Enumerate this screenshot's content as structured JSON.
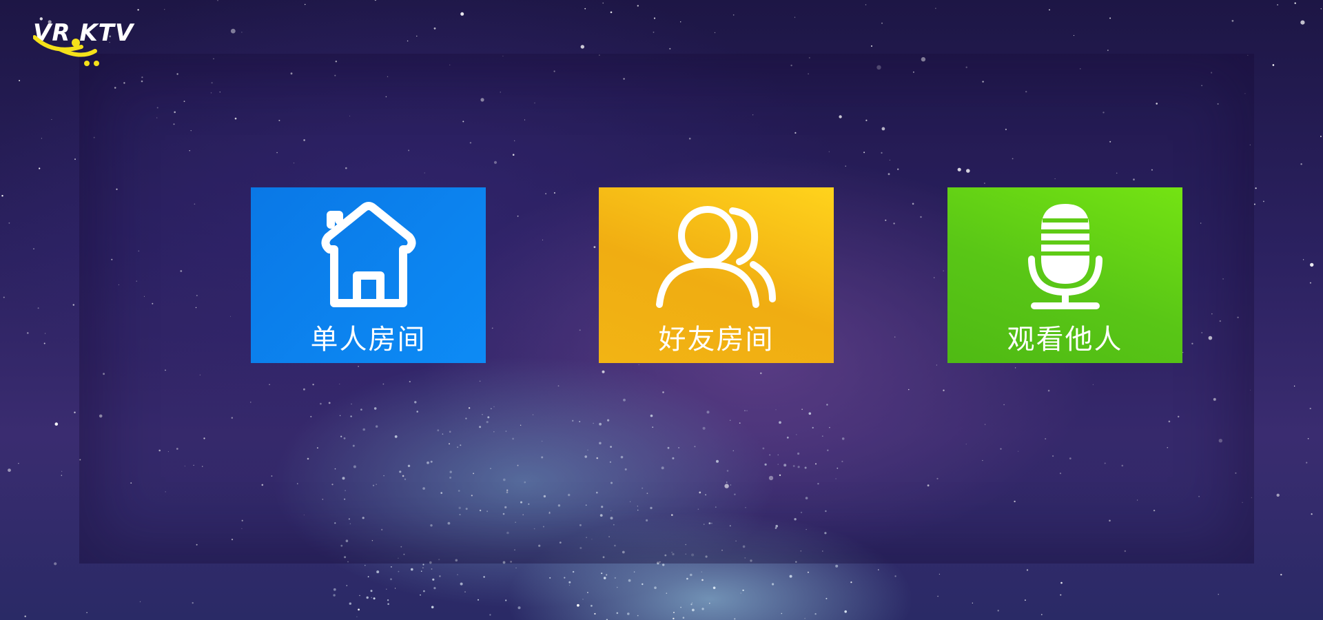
{
  "app": {
    "logo_text": "VR KTV",
    "logo_icon": "smile-cart-icon"
  },
  "menu": {
    "tiles": [
      {
        "label": "单人房间",
        "icon": "house-icon",
        "color": "#0a7fee"
      },
      {
        "label": "好友房间",
        "icon": "users-icon",
        "color": "#f3b312"
      },
      {
        "label": "观看他人",
        "icon": "microphone-icon",
        "color": "#5fcb15"
      }
    ]
  },
  "theme": {
    "background": "#2b2160",
    "text": "#ffffff"
  }
}
